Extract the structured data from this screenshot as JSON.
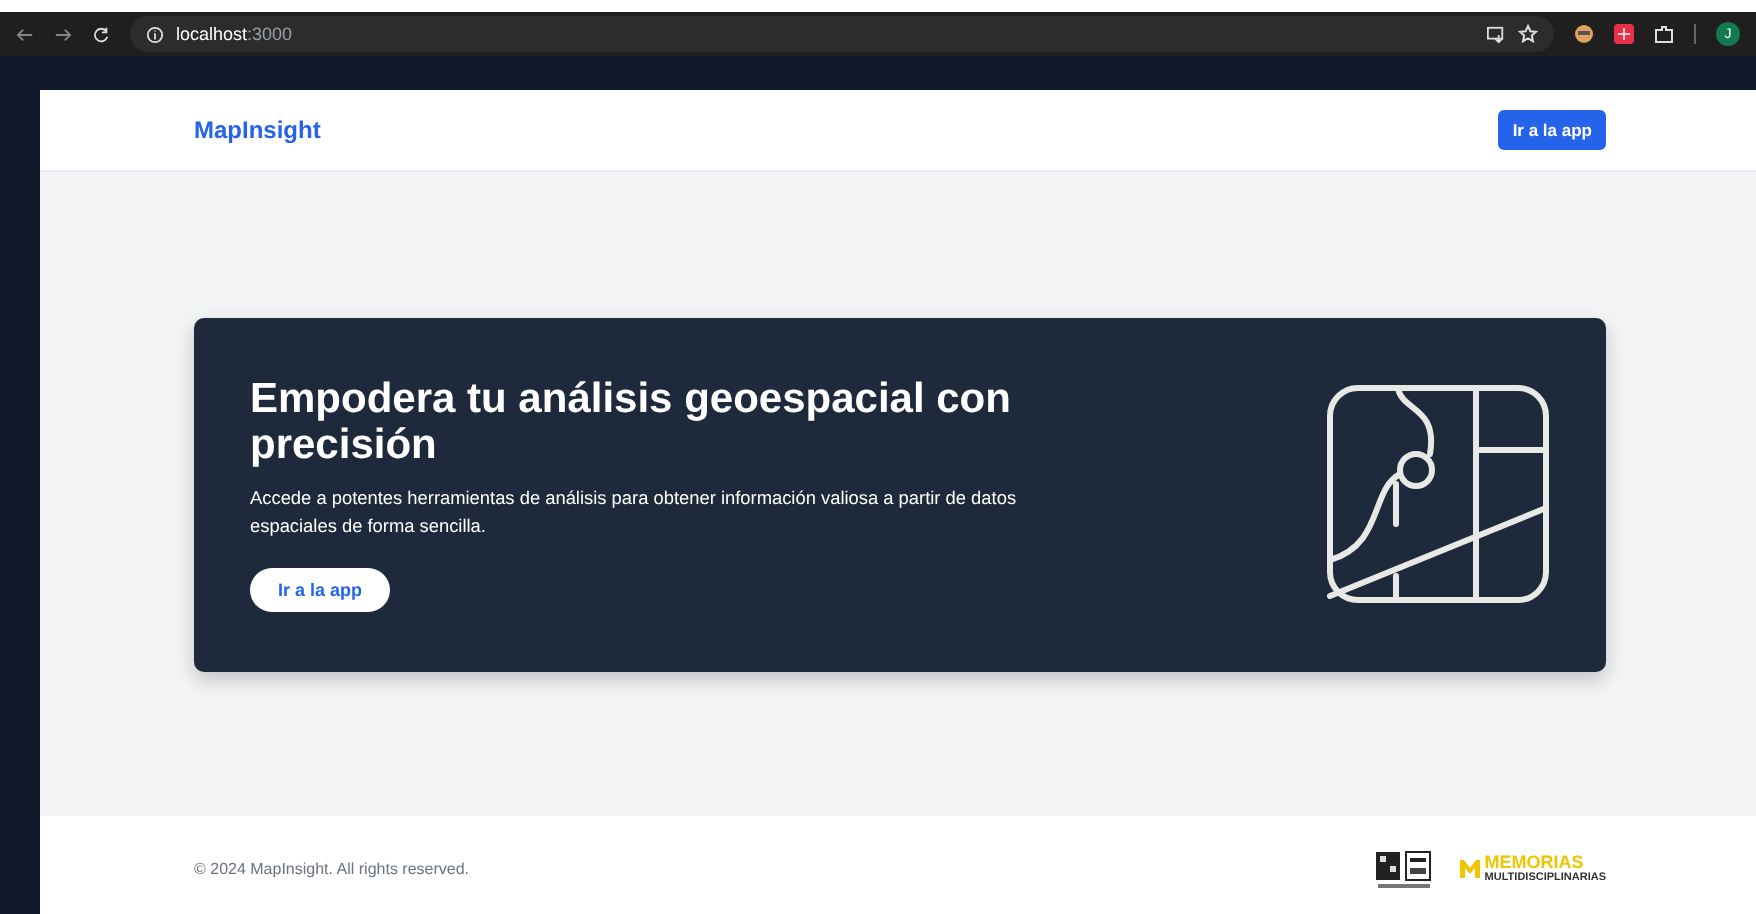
{
  "browser": {
    "url_host": "localhost",
    "url_port": ":3000",
    "profile_initial": "J"
  },
  "header": {
    "brand": "MapInsight",
    "button": "Ir a la app"
  },
  "hero": {
    "title": "Empodera tu análisis geoespacial con precisión",
    "text": "Accede a potentes herramientas de análisis para obtener información valiosa a partir de datos espaciales de forma sencilla.",
    "button": "Ir a la app"
  },
  "footer": {
    "copyright": "© 2024 MapInsight. All rights reserved.",
    "logo_title": "MEMORIAS",
    "logo_subtitle": "MULTIDISCIPLINARIAS"
  }
}
